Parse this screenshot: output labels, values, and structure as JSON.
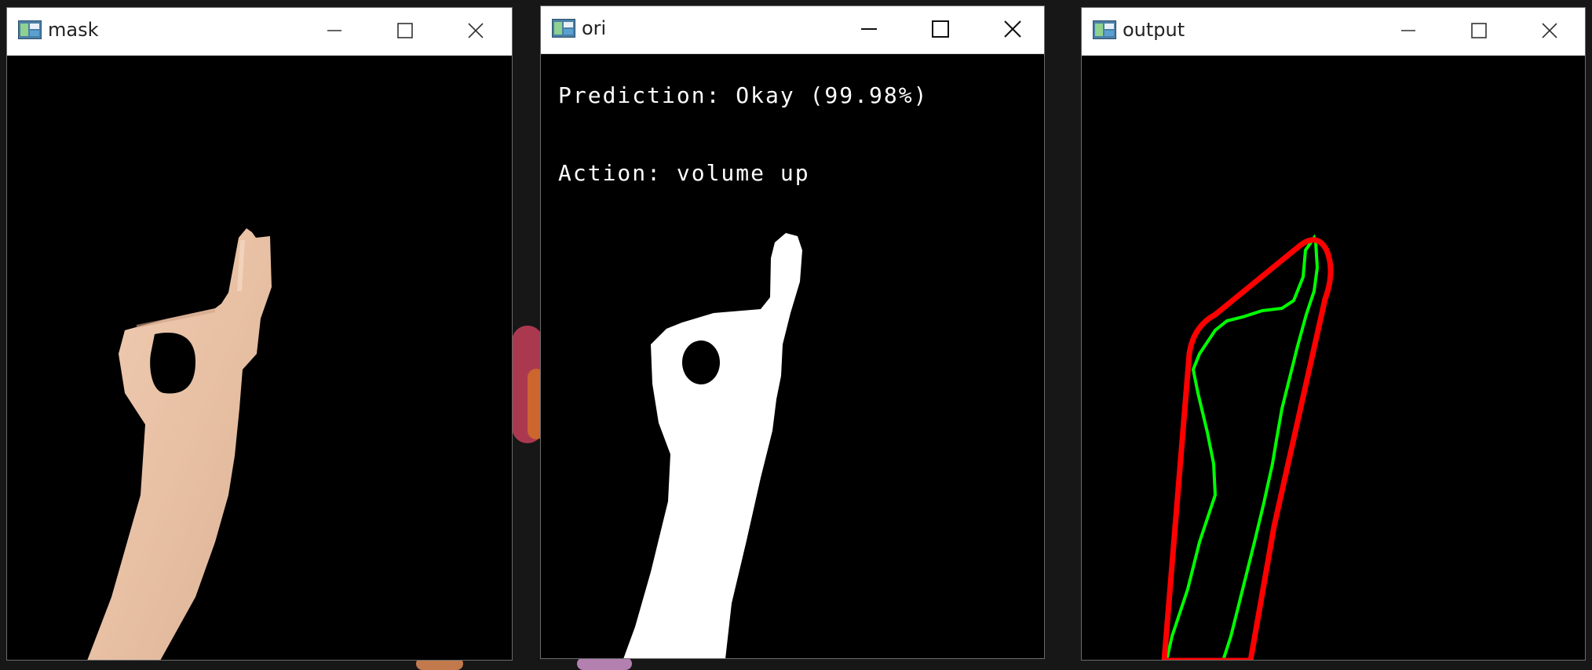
{
  "windows": {
    "mask": {
      "title": "mask"
    },
    "ori": {
      "title": "ori",
      "prediction_text": "Prediction: Okay (99.98%)",
      "action_text": "Action: volume up"
    },
    "output": {
      "title": "output"
    }
  },
  "icons": {
    "app": "opencv-window-icon",
    "minimize": "minimize-icon",
    "maximize": "maximize-icon",
    "close": "close-icon"
  },
  "colors": {
    "contour": "#ff0000",
    "defects": "#00ff00",
    "skin": "#e9c3a8",
    "mask_fg": "#ffffff"
  }
}
